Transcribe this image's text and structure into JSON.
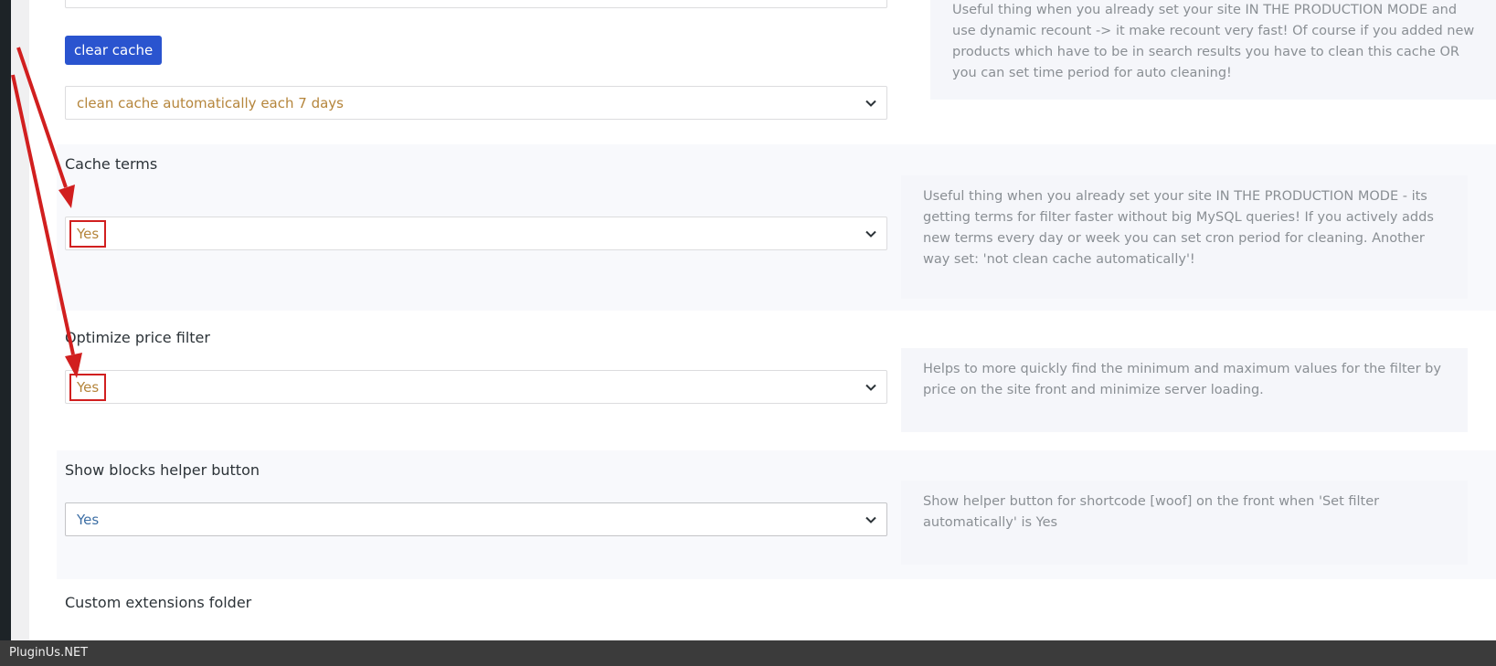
{
  "cache_block": {
    "clear_button_label": "clear cache",
    "auto_clean_select_value": "clean cache automatically each 7 days",
    "help_text": "Useful thing when you already set your site IN THE PRODUCTION MODE and use dynamic recount -> it make recount very fast! Of course if you added new products which have to be in search results you have to clean this cache OR you can set time period for auto cleaning!"
  },
  "cache_terms": {
    "label": "Cache terms",
    "select_value": "Yes",
    "help_text": "Useful thing when you already set your site IN THE PRODUCTION MODE - its getting terms for filter faster without big MySQL queries! If you actively adds new terms every day or week you can set cron period for cleaning. Another way set: 'not clean cache automatically'!"
  },
  "optimize_price_filter": {
    "label": "Optimize price filter",
    "select_value": "Yes",
    "help_text": "Helps to more quickly find the minimum and maximum values for the filter by price on the site front and minimize server loading."
  },
  "show_blocks_helper": {
    "label": "Show blocks helper button",
    "select_value": "Yes",
    "help_text": "Show helper button for shortcode [woof] on the front when 'Set filter automatically' is Yes"
  },
  "custom_extensions": {
    "label": "Custom extensions folder"
  },
  "footer": {
    "watermark": "PluginUs.NET"
  },
  "colors": {
    "accent_button": "#2a54cf",
    "select_text": "#b5853b",
    "select_text_active": "#3d6fa5",
    "annotation_red": "#d11f1f"
  }
}
